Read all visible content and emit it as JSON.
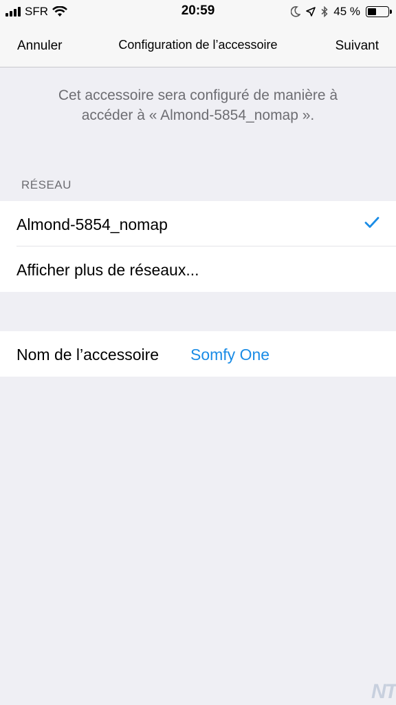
{
  "status_bar": {
    "carrier": "SFR",
    "time": "20:59",
    "battery_percent": "45 %",
    "battery_level": 0.45
  },
  "nav": {
    "cancel_label": "Annuler",
    "title": "Configuration de l’accessoire",
    "next_label": "Suivant"
  },
  "description": {
    "line1": "Cet accessoire sera configuré de manière à",
    "line2": "accéder à « Almond-5854_nomap »."
  },
  "network_section": {
    "header": "RÉSEAU",
    "items": [
      {
        "label": "Almond-5854_nomap",
        "selected": true
      },
      {
        "label": "Afficher plus de réseaux..."
      }
    ]
  },
  "accessory": {
    "name_label": "Nom de l’accessoire",
    "name_value": "Somfy One"
  },
  "watermark": "NT",
  "colors": {
    "accent": "#1a8ce6",
    "background": "#efeff4",
    "secondary_text": "#6d6d72"
  }
}
